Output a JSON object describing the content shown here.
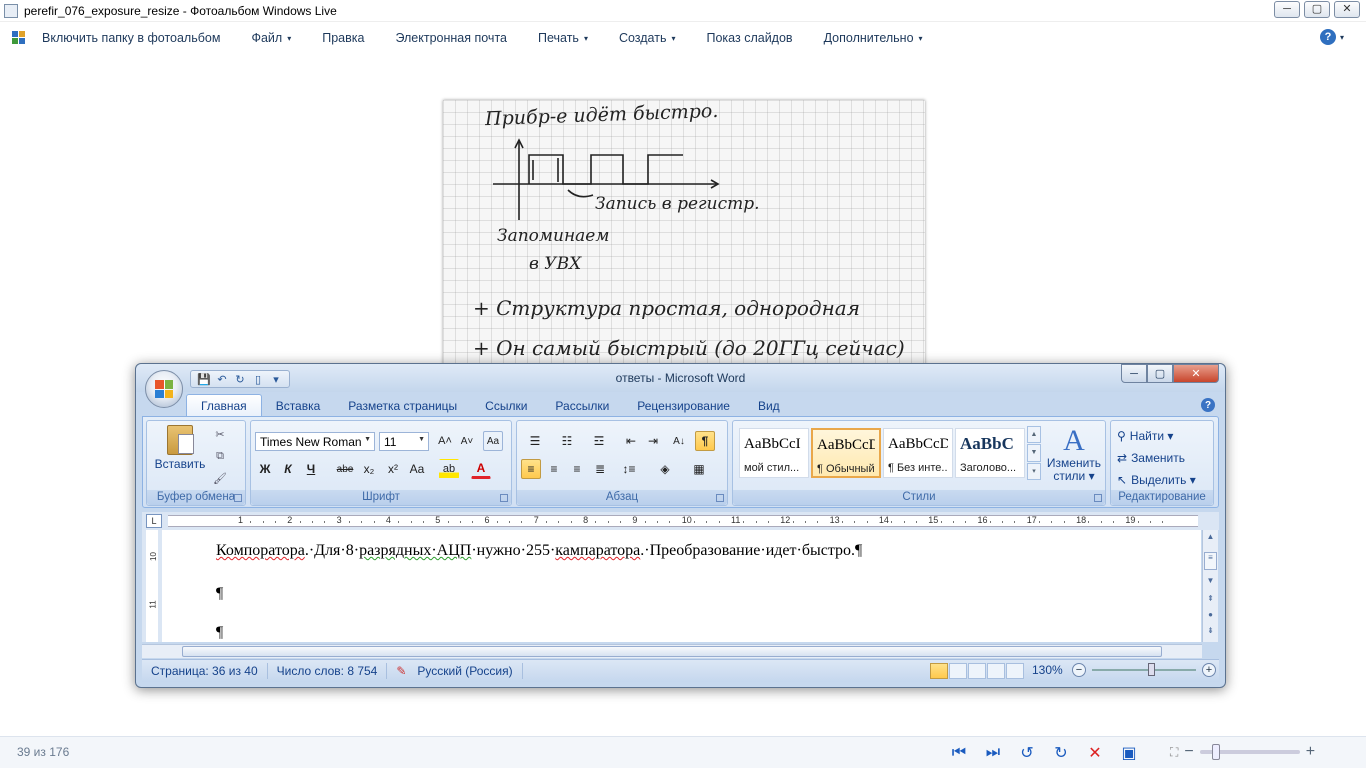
{
  "gallery": {
    "title": "perefir_076_exposure_resize - Фотоальбом Windows Live",
    "window_buttons": {
      "minimize": "─",
      "maximize": "▢",
      "close": "✕"
    },
    "menu": [
      {
        "label": "Включить папку в фотоальбом"
      },
      {
        "label": "Файл",
        "caret": "▾"
      },
      {
        "label": "Правка"
      },
      {
        "label": "Электронная почта"
      },
      {
        "label": "Печать",
        "caret": "▾"
      },
      {
        "label": "Создать",
        "caret": "▾"
      },
      {
        "label": "Показ слайдов"
      },
      {
        "label": "Дополнительно",
        "caret": "▾"
      }
    ],
    "help": {
      "glyph": "?",
      "caret": "▾"
    },
    "photo_count": "39 из 176",
    "nav": {
      "prev": "⏮",
      "next": "⏭",
      "rotate_left": "↺",
      "rotate_right": "↻",
      "delete": "✕",
      "slideshow": "▣"
    },
    "zoom": {
      "minus": "−",
      "plus": "+",
      "fit": "⛶"
    },
    "handwriting": {
      "line1": "Прибр-е идёт быстро.",
      "line2": "Запись в регистр.",
      "line3": "Запоминаем",
      "line4": "в УВХ",
      "line5": "+ Структура простая, однородная",
      "line6": "+ Он самый быстрый (до 20ГГц сейчас)"
    }
  },
  "word": {
    "title": "ответы - Microsoft Word",
    "window_buttons": {
      "minimize": "─",
      "maximize": "▢",
      "close": "✕"
    },
    "qat": {
      "save": "💾",
      "undo": "↶",
      "redo": "↻",
      "print_preview": "▯",
      "more": "▾"
    },
    "tabs": [
      "Главная",
      "Вставка",
      "Разметка страницы",
      "Ссылки",
      "Рассылки",
      "Рецензирование",
      "Вид"
    ],
    "ribbon_help": "?",
    "clipboard": {
      "paste_label": "Вставить",
      "group_label": "Буфер обмена",
      "cut": "✂",
      "copy": "⧉",
      "format_painter": "🖌"
    },
    "font": {
      "name": "Times New Roman",
      "size": "11",
      "grow": "A˄",
      "shrink": "A˅",
      "clear": "Aa",
      "bold": "Ж",
      "italic": "К",
      "underline": "Ч",
      "strike": "abe",
      "subscript": "x₂",
      "superscript": "x²",
      "case": "Aa",
      "highlight": "ab",
      "color": "A",
      "group_label": "Шрифт"
    },
    "paragraph": {
      "group_label": "Абзац",
      "pilcrow": "¶",
      "sort": "A↓"
    },
    "styles": {
      "group_label": "Стили",
      "tiles": [
        {
          "sample": "AaBbCcI",
          "name": "мой стил..."
        },
        {
          "sample": "AaBbCcDc",
          "name": "¶ Обычный"
        },
        {
          "sample": "AaBbCcDc",
          "name": "¶ Без инте..."
        },
        {
          "sample": "AaBbC",
          "name": "Заголово..."
        }
      ],
      "change_label_1": "Изменить",
      "change_label_2": "стили ▾"
    },
    "editing": {
      "group_label": "Редактирование",
      "find": "Найти ▾",
      "replace": "Заменить",
      "select": "Выделить ▾"
    },
    "ruler_numbers": [
      "1",
      "2",
      "3",
      "4",
      "5",
      "6",
      "7",
      "8",
      "9",
      "10",
      "11",
      "12",
      "13",
      "14",
      "15",
      "16",
      "17",
      "18",
      "19"
    ],
    "vruler_numbers": [
      "10",
      "11"
    ],
    "ruler_tab": "L",
    "document": {
      "p1_parts": [
        {
          "t": "Компоратора",
          "c": "sq"
        },
        {
          "t": ".·Для·8·",
          "c": ""
        },
        {
          "t": "разрядных·АЦП",
          "c": "gr"
        },
        {
          "t": "·нужно·255·",
          "c": ""
        },
        {
          "t": "кампаратора",
          "c": "sq"
        },
        {
          "t": ".·Преобразование·идет·быстро.¶",
          "c": ""
        }
      ],
      "p2": "¶",
      "p3": "¶"
    },
    "status": {
      "page": "Страница: 36 из 40",
      "words": "Число слов: 8 754",
      "language": "Русский (Россия)",
      "zoom": "130%",
      "zoom_minus": "−",
      "zoom_plus": "+"
    }
  }
}
